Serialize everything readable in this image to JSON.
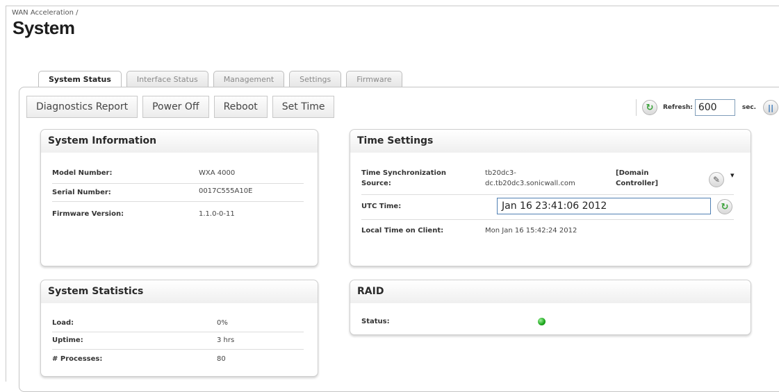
{
  "breadcrumb": "WAN Acceleration /",
  "title": "System",
  "tabs": [
    {
      "label": "System Status",
      "active": true
    },
    {
      "label": "Interface Status",
      "active": false
    },
    {
      "label": "Management",
      "active": false
    },
    {
      "label": "Settings",
      "active": false
    },
    {
      "label": "Firmware",
      "active": false
    }
  ],
  "toolbar": {
    "diagnostics": "Diagnostics Report",
    "power_off": "Power Off",
    "reboot": "Reboot",
    "set_time": "Set Time"
  },
  "refresh": {
    "label": "Refresh:",
    "value": "600",
    "unit": "sec."
  },
  "system_information": {
    "title": "System Information",
    "rows": [
      {
        "label": "Model Number:",
        "value": "WXA 4000"
      },
      {
        "label": "Serial Number:",
        "value": "0017C555A10E"
      },
      {
        "label": "Firmware Version:",
        "value": "1.1.0-0-11"
      }
    ]
  },
  "time_settings": {
    "title": "Time Settings",
    "sync_label_1": "Time Synchronization",
    "sync_label_2": "Source:",
    "sync_value_1": "tb20dc3-",
    "sync_value_2": "dc.tb20dc3.sonicwall.com",
    "sync_type_1": "[Domain",
    "sync_type_2": "Controller]",
    "utc_label": "UTC Time:",
    "utc_value": "Jan 16 23:41:06 2012",
    "local_label": "Local Time on Client:",
    "local_value": "Mon Jan 16 15:42:24 2012"
  },
  "system_statistics": {
    "title": "System Statistics",
    "rows": [
      {
        "label": "Load:",
        "value": "0%"
      },
      {
        "label": "Uptime:",
        "value": "3 hrs"
      },
      {
        "label": "# Processes:",
        "value": "80"
      }
    ]
  },
  "raid": {
    "title": "RAID",
    "status_label": "Status:",
    "status_color": "#1aa51a"
  },
  "icons": {
    "refresh": "↻",
    "pause": "||",
    "edit": "✎",
    "dropdown": "▾"
  }
}
